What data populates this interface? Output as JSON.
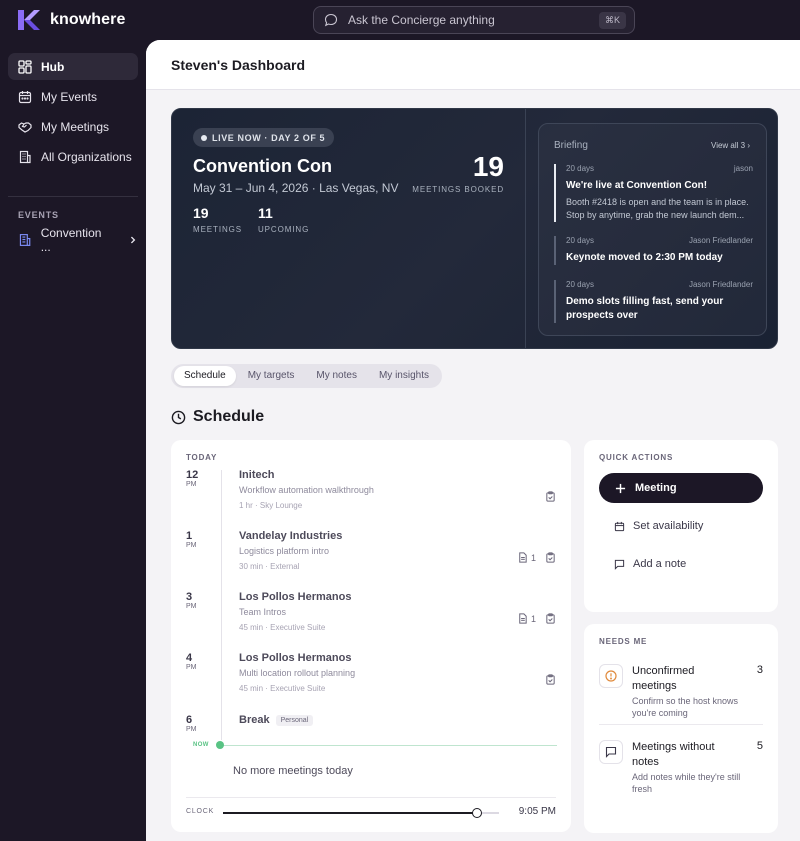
{
  "app": {
    "name": "knowhere",
    "brand_color": "#7b5cf0"
  },
  "search": {
    "placeholder": "Ask the Concierge anything",
    "shortcut": "⌘K"
  },
  "sidebar": {
    "items": [
      {
        "label": "Hub",
        "icon": "hub-icon"
      },
      {
        "label": "My Events",
        "icon": "calendar-icon"
      },
      {
        "label": "My Meetings",
        "icon": "handshake-icon"
      },
      {
        "label": "All Organizations",
        "icon": "building-icon"
      }
    ],
    "section_label": "EVENTS",
    "event": {
      "label": "Convention ...",
      "icon": "building-icon"
    }
  },
  "header": {
    "title": "Steven's Dashboard"
  },
  "hero": {
    "live_label": "LIVE NOW · DAY 2 OF 5",
    "event_name": "Convention Con",
    "event_dates": "May 31 – Jun 4, 2026 · Las Vegas, NV",
    "meetings_booked": "19",
    "meetings_booked_label": "MEETINGS BOOKED",
    "stats": [
      {
        "value": "19",
        "label": "MEETINGS"
      },
      {
        "value": "11",
        "label": "UPCOMING"
      }
    ]
  },
  "briefing": {
    "title": "Briefing",
    "view_all": "View all 3",
    "items": [
      {
        "age": "20 days",
        "author": "jason",
        "headline": "We're live at Convention Con!",
        "body": "Booth #2418 is open and the team is in place. Stop by anytime, grab the new launch dem..."
      },
      {
        "age": "20 days",
        "author": "Jason Friedlander",
        "headline": "Keynote moved to 2:30 PM today",
        "body": ""
      },
      {
        "age": "20 days",
        "author": "Jason Friedlander",
        "headline": "Demo slots filling fast, send your prospects over",
        "body": ""
      }
    ]
  },
  "tabs": [
    "Schedule",
    "My targets",
    "My notes",
    "My insights"
  ],
  "schedule": {
    "title": "Schedule",
    "day_label": "TODAY",
    "slots": [
      {
        "hour": "12",
        "ampm": "PM",
        "title": "Initech",
        "subtitle": "Workflow automation walkthrough",
        "meta": "1 hr · Sky Lounge",
        "notes": ""
      },
      {
        "hour": "1",
        "ampm": "PM",
        "title": "Vandelay Industries",
        "subtitle": "Logistics platform intro",
        "meta": "30 min · External",
        "notes": "1"
      },
      {
        "hour": "3",
        "ampm": "PM",
        "title": "Los Pollos Hermanos",
        "subtitle": "Team Intros",
        "meta": "45 min · Executive Suite",
        "notes": "1"
      },
      {
        "hour": "4",
        "ampm": "PM",
        "title": "Los Pollos Hermanos",
        "subtitle": "Multi location rollout planning",
        "meta": "45 min · Executive Suite",
        "notes": ""
      },
      {
        "hour": "6",
        "ampm": "PM",
        "title": "Break",
        "tag": "Personal"
      }
    ],
    "now_label": "NOW",
    "empty_message": "No more meetings today",
    "clock_label": "CLOCK",
    "clock_time": "9:05 PM",
    "clock_progress": 0.92
  },
  "quick_actions": {
    "label": "QUICK ACTIONS",
    "primary": "Meeting",
    "set_availability": "Set availability",
    "add_note": "Add a note"
  },
  "needs_me": {
    "label": "NEEDS ME",
    "items": [
      {
        "title": "Unconfirmed meetings",
        "count": "3",
        "subtitle": "Confirm so the host knows you're coming",
        "icon": "alert-circle-icon"
      },
      {
        "title": "Meetings without notes",
        "count": "5",
        "subtitle": "Add notes while they're still fresh",
        "icon": "message-icon"
      }
    ]
  }
}
